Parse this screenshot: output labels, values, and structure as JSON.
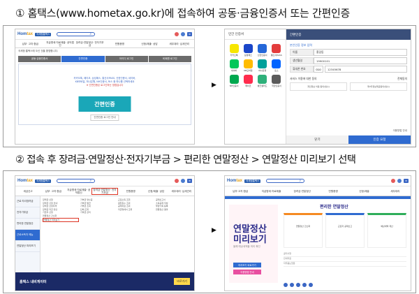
{
  "step1": {
    "title": "① 홈택스(www.hometax.go.kr)에 접속하여 공동·금융인증서 또는 간편인증"
  },
  "step2": {
    "title": "② 접속 후 장려금·연말정산·전자기부금 > 편리한 연말정산 > 연말정산 미리보기 선택"
  },
  "arrow": "▶",
  "shot1": {
    "logo_main": "Hom",
    "logo_accent": "tax",
    "logo_tag": "국세청홈택스",
    "menu": [
      "납부·\n고지·환급",
      "지급명세·자료제출·\n공익법인",
      "장려금·연말정산·\n전자기부금",
      "민원증명",
      "신청/제출·\n상담",
      "세무대리·\n납세관리"
    ],
    "notice": "국세청 홈택스에 오신 것을 환영합니다.",
    "tabs": [
      "공동·금융인증서",
      "간편인증",
      "아이디 로그인",
      "비회원 로그인"
    ],
    "hint1": "카카오톡, 페이코, 삼성패스, 통신사PASS, 신한인증서, 네이버,",
    "hint2": "KB모바일, 하나은행, NH인증서, 토스 중 하나를 선택하세요",
    "hint3": "※ 간편인증은 로그인하는 방법입니다",
    "big_button": "간편인증",
    "sub_button": "간편인증 로그인 안내"
  },
  "shot2": {
    "left_head": "민간 인증서",
    "apps": [
      "카카오톡",
      "삼성패스",
      "신한인증서",
      "통신사PASS",
      "네이버",
      "KB모바일",
      "하나은행",
      "토스",
      "NH인증서",
      "페이코",
      "뱅크샐러드",
      "국민인증서"
    ],
    "app_colors": [
      "#f7e600",
      "#1a46c9",
      "#2467d8",
      "#e33c3c",
      "#03c75a",
      "#ffbc00",
      "#00a09a",
      "#0064ff",
      "#00a84f",
      "#ff2c4d",
      "#2fb07a",
      "#5b5b5b"
    ],
    "right_head": "간편인증",
    "form_title": "본인인증 정보 입력",
    "name_label": "이름",
    "name_value": "홍길동",
    "birth_label": "생년월일",
    "birth_value": "19900101",
    "phone_label": "휴대폰 번호",
    "phone_prefix": "010",
    "phone_value": "12345678",
    "consent_label": "서비스 이용에 대한 동의",
    "consent_all": "전체동의",
    "consent_items": [
      "개인정보 이용 동의(필수)",
      "제3자정보제공동의(필수)"
    ],
    "note": "이용방법 안내",
    "close": "닫기",
    "confirm": "인증 요청"
  },
  "shot3": {
    "menu": [
      "세금신고",
      "납부·\n고지·환급",
      "지급명세·자료제출·\n공익법인",
      "장려금·연말정산·\n전자기부금",
      "민원증명",
      "신청/제출·\n상담",
      "세무대리·\n납세관리"
    ],
    "side": [
      "근로·자녀장려금",
      "전자기부금",
      "편리한 연말정산",
      "근로소득자 메뉴",
      "연말정산 미리보기"
    ],
    "col1": [
      "장려금 신청",
      "장려금 신청 안내",
      "장려금 신청자격",
      "장려금 지급·정산",
      "기한후 신청",
      "연말정산 간소화",
      "연말정산 미리보기"
    ],
    "col2": [
      "기부금 영수증",
      "기부금 발급",
      "기부금 조회",
      "단체 조회",
      "기부금 관리"
    ],
    "col3": [
      "근로소득 조회",
      "원천징수 조회",
      "공제자료 조회",
      "지급명세서 조회"
    ],
    "col4": [
      "공제신고서",
      "소득공제 작성",
      "부양가족 등록",
      "연말정산 결과"
    ],
    "banner_title": "홈택스 내비게이터",
    "banner_button": "바로가기"
  },
  "shot4": {
    "menu": [
      "납부·고지·환급",
      "지급명세·자료제출",
      "장려금·연말정산",
      "민원증명",
      "신청/제출",
      "세무대리"
    ],
    "center_title": "편리한 연말정산",
    "promo_title": "연말정산\n미리보기",
    "promo_sub": "올해 예상세액을 미리 확인",
    "promo_btn1": "미리보기 바로가기",
    "promo_btn2": "이용방법 안내",
    "cards": [
      "연말정산 간소화",
      "근로자 공제신고",
      "예상세액 계산"
    ],
    "rows": [
      "공지사항",
      "안내자료",
      "자주묻는질문"
    ]
  }
}
